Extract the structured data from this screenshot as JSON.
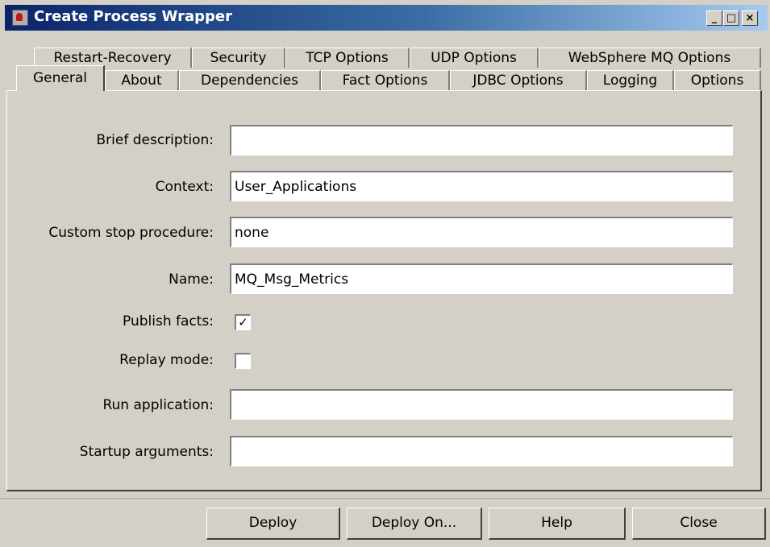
{
  "window": {
    "title": "Create Process Wrapper",
    "icon": "process-wrapper-icon",
    "controls": {
      "minimize": "_",
      "maximize": "□",
      "close": "×"
    }
  },
  "tabs": {
    "row_back": [
      "Restart-Recovery",
      "Security",
      "TCP Options",
      "UDP Options",
      "WebSphere MQ Options"
    ],
    "row_front": [
      "General",
      "About",
      "Dependencies",
      "Fact Options",
      "JDBC Options",
      "Logging",
      "Options"
    ],
    "active": "General"
  },
  "form": {
    "brief_description": {
      "label": "Brief description:",
      "value": ""
    },
    "context": {
      "label": "Context:",
      "value": "User_Applications"
    },
    "custom_stop_procedure": {
      "label": "Custom stop procedure:",
      "value": "none"
    },
    "name": {
      "label": "Name:",
      "value": "MQ_Msg_Metrics"
    },
    "publish_facts": {
      "label": "Publish facts:",
      "checked": true,
      "mark": "✓"
    },
    "replay_mode": {
      "label": "Replay mode:",
      "checked": false,
      "mark": ""
    },
    "run_application": {
      "label": "Run application:",
      "value": ""
    },
    "startup_arguments": {
      "label": "Startup arguments:",
      "value": ""
    }
  },
  "buttons": {
    "deploy": "Deploy",
    "deploy_on": "Deploy On...",
    "help": "Help",
    "close": "Close"
  }
}
